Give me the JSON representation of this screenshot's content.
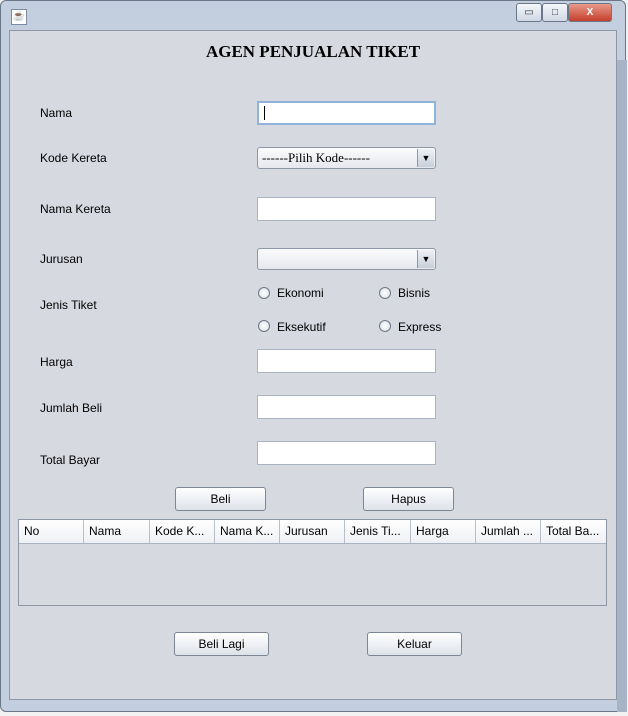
{
  "window": {
    "title": "",
    "minimize_label": "▭",
    "maximize_label": "□",
    "close_label": "X"
  },
  "heading": "AGEN PENJUALAN TIKET",
  "form": {
    "nama_label": "Nama",
    "nama_value": "",
    "kode_kereta_label": "Kode Kereta",
    "kode_kereta_selected": "------Pilih Kode------",
    "nama_kereta_label": "Nama Kereta",
    "nama_kereta_value": "",
    "jurusan_label": "Jurusan",
    "jurusan_selected": "",
    "jenis_tiket_label": "Jenis Tiket",
    "options": [
      "Ekonomi",
      "Bisnis",
      "Eksekutif",
      "Express"
    ],
    "harga_label": "Harga",
    "harga_value": "",
    "jumlah_beli_label": "Jumlah Beli",
    "jumlah_beli_value": "",
    "total_bayar_label": "Total Bayar",
    "total_bayar_value": ""
  },
  "buttons": {
    "beli": "Beli",
    "hapus": "Hapus",
    "beli_lagi": "Beli Lagi",
    "keluar": "Keluar"
  },
  "table": {
    "columns": [
      "No",
      "Nama",
      "Kode K...",
      "Nama K...",
      "Jurusan",
      "Jenis Ti...",
      "Harga",
      "Jumlah ...",
      "Total Ba..."
    ],
    "rows": []
  },
  "icons": {
    "dropdown": "▼"
  }
}
